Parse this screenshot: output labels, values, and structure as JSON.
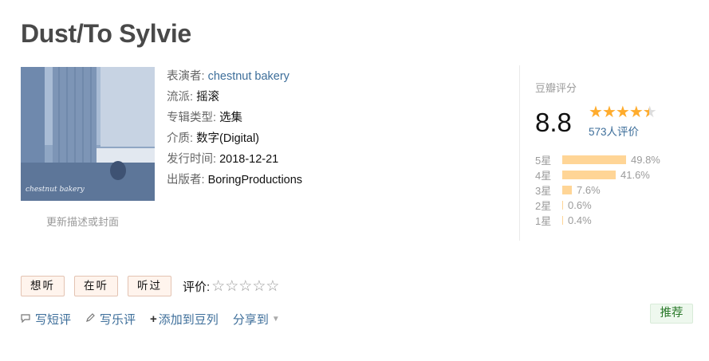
{
  "title": "Dust/To Sylvie",
  "cover": {
    "caption": "chestnut bakery",
    "update_link": "更新描述或封面"
  },
  "info": {
    "performer_label": "表演者:",
    "performer": "chestnut bakery",
    "genre_label": "流派:",
    "genre": "摇滚",
    "type_label": "专辑类型:",
    "type": "选集",
    "medium_label": "介质:",
    "medium": "数字(Digital)",
    "date_label": "发行时间:",
    "date": "2018-12-21",
    "publisher_label": "出版者:",
    "publisher": "BoringProductions"
  },
  "rating": {
    "label": "豆瓣评分",
    "score": "8.8",
    "stars_value": 4.5,
    "votes": "573人评价",
    "distribution": [
      {
        "star": "5星",
        "pct": "49.8%",
        "fraction": 0.498
      },
      {
        "star": "4星",
        "pct": "41.6%",
        "fraction": 0.416
      },
      {
        "star": "3星",
        "pct": "7.6%",
        "fraction": 0.076
      },
      {
        "star": "2星",
        "pct": "0.6%",
        "fraction": 0.006
      },
      {
        "star": "1星",
        "pct": "0.4%",
        "fraction": 0.004
      }
    ],
    "star_color": "#ffac2d",
    "bar_color": "#ffd596"
  },
  "actions": {
    "want": "想听",
    "listening": "在听",
    "listened": "听过",
    "rate_label": "评价:"
  },
  "links": {
    "short_review": "写短评",
    "review": "写乐评",
    "add_doulist": "添加到豆列",
    "share": "分享到"
  },
  "recommend": "推荐"
}
